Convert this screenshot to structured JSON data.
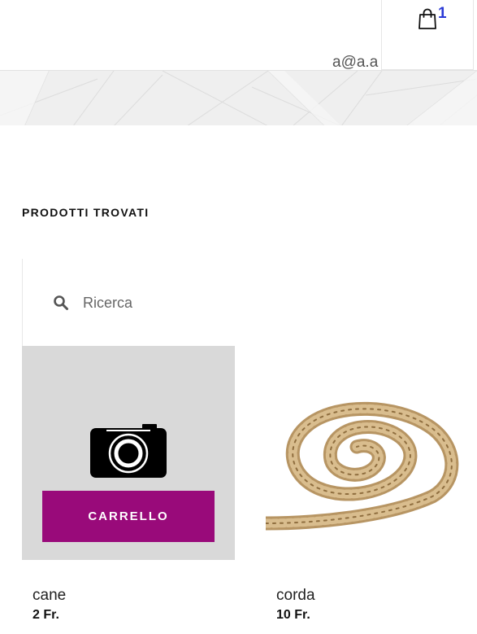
{
  "header": {
    "cart_count": "1",
    "user_email": "a@a.a",
    "cart_icon": "shopping-bag-icon"
  },
  "colors": {
    "accent": "#990a7a",
    "cart_count": "#2b3ad6",
    "placeholder_bg": "#d9d9d9"
  },
  "section": {
    "title": "PRODOTTI TROVATI"
  },
  "search": {
    "placeholder": "Ricerca",
    "value": "",
    "icon": "search-icon"
  },
  "products": [
    {
      "name": "cane",
      "price": "2 Fr.",
      "image": "camera-placeholder-icon",
      "button_label": "CARRELLO"
    },
    {
      "name": "corda",
      "price": "10 Fr.",
      "image": "rope-image"
    }
  ]
}
